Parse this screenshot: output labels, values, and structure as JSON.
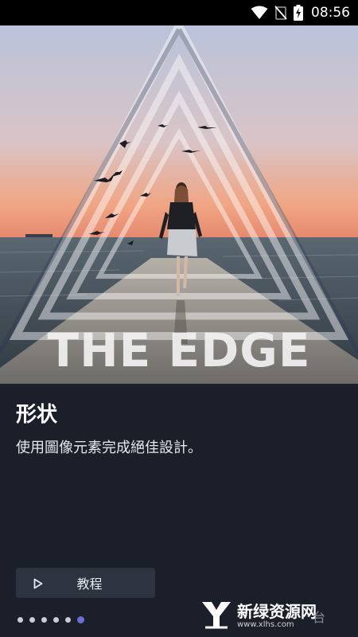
{
  "status_bar": {
    "time": "08:56",
    "icons": [
      "wifi-icon",
      "no-signal-icon",
      "battery-charging-icon"
    ]
  },
  "hero": {
    "image_text": "THE EDGE",
    "colors": {
      "sky_top": "#c3cbe0",
      "sky_bottom": "#f1a07e",
      "sea": "#4c5661",
      "pier": "#8c8b86"
    }
  },
  "feature": {
    "title": "形状",
    "description": "使用圖像元素完成絕佳設計。"
  },
  "tutorial_button": {
    "label": "教程",
    "icon": "play-icon"
  },
  "pagination": {
    "total": 6,
    "active_index": 5,
    "active_color": "#6b6fd6"
  },
  "watermark": {
    "text": "新绿资源网",
    "url": "www.xlhs.com",
    "extra": "台"
  }
}
